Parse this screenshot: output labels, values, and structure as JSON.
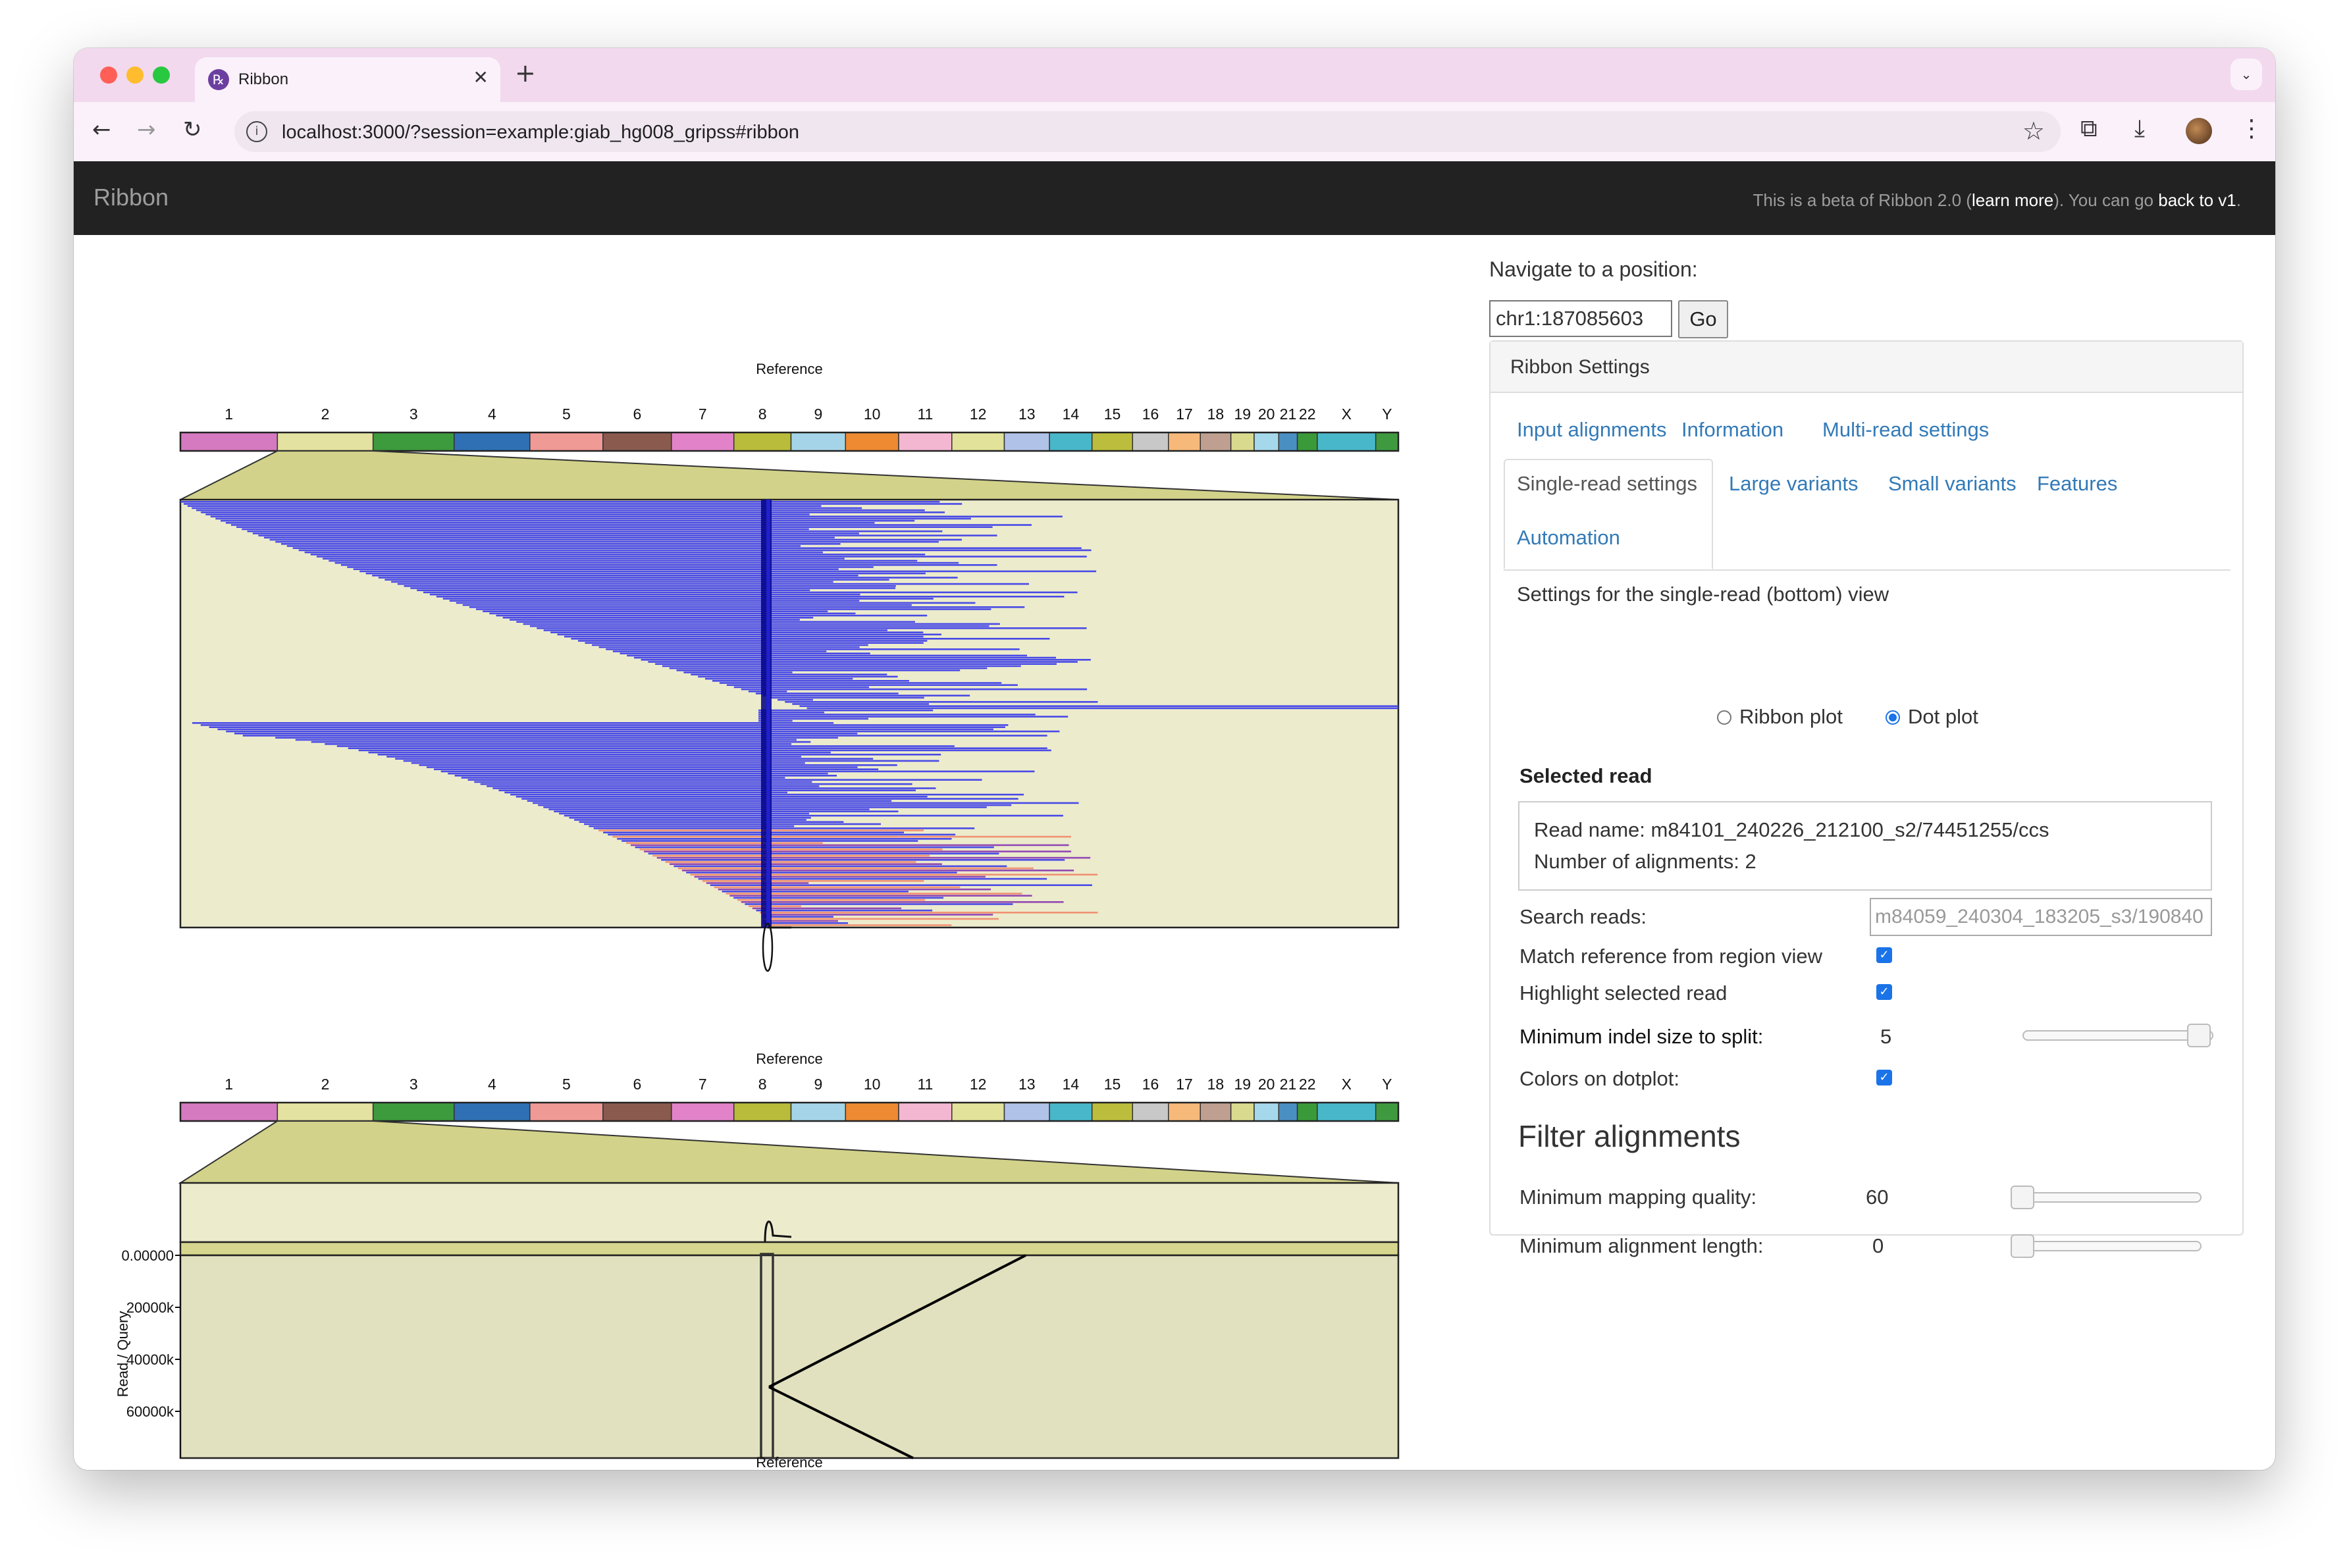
{
  "browser": {
    "tab_title": "Ribbon",
    "tab_icon": "ribbon-favicon",
    "url": "localhost:3000/?session=example:giab_hg008_gripss#ribbon"
  },
  "navbar": {
    "brand": "Ribbon",
    "beta_prefix": "This is a beta of Ribbon 2.0 (",
    "learn_more": "learn more",
    "beta_middle": "). You can go ",
    "back_link": "back to v1",
    "beta_suffix": "."
  },
  "plots": {
    "reference_label": "Reference",
    "chromosomes": [
      "1",
      "2",
      "3",
      "4",
      "5",
      "6",
      "7",
      "8",
      "9",
      "10",
      "11",
      "12",
      "13",
      "14",
      "15",
      "16",
      "17",
      "18",
      "19",
      "20",
      "21",
      "22",
      "X",
      "Y"
    ],
    "chromosome_colors": [
      "#d579c0",
      "#e3e2a0",
      "#3d9a3d",
      "#2f70b4",
      "#f09a95",
      "#8a5a4e",
      "#e283c9",
      "#b9bc3a",
      "#a5d4e8",
      "#ed8a32",
      "#f4b7d2",
      "#e2e29a",
      "#b0c2e8",
      "#48b7c9",
      "#bcbd3c",
      "#c8c8c8",
      "#f6b97a",
      "#bfa090",
      "#dada8e",
      "#a6d8ec",
      "#4a8fc2",
      "#3a9a3a",
      "#48b7c9",
      "#3f9a3f"
    ],
    "dotplot_y_ticks": [
      "0.00000",
      "20000k",
      "40000k",
      "60000k"
    ],
    "dotplot_y_label": "Read / Query"
  },
  "panel": {
    "navigate_label": "Navigate to a position:",
    "position_value": "chr1:187085603",
    "go_label": "Go",
    "settings_title": "Ribbon Settings",
    "tabs": {
      "input": "Input alignments",
      "information": "Information",
      "multi_read": "Multi-read settings",
      "single_read": "Single-read settings",
      "large_variants": "Large variants",
      "small_variants": "Small variants",
      "features": "Features",
      "automation": "Automation"
    },
    "single_read_desc": "Settings for the single-read (bottom) view",
    "ribbon_plot_label": "Ribbon plot",
    "dot_plot_label": "Dot plot",
    "selected_plot": "Dot plot",
    "selected_read_title": "Selected read",
    "read_name": "Read name: m84101_240226_212100_s2/74451255/ccs",
    "num_alignments": "Number of alignments: 2",
    "search_label": "Search reads:",
    "search_placeholder": "m84059_240304_183205_s3/190840",
    "match_ref_label": "Match reference from region view",
    "match_ref_checked": true,
    "highlight_label": "Highlight selected read",
    "highlight_checked": true,
    "min_indel_label": "Minimum indel size to split:",
    "min_indel_value": "5",
    "colors_dotplot_label": "Colors on dotplot:",
    "colors_dotplot_checked": true,
    "filter_title": "Filter alignments",
    "min_mapq_label": "Minimum mapping quality:",
    "min_mapq_value": "60",
    "min_len_label": "Minimum alignment length:",
    "min_len_value": "0"
  }
}
